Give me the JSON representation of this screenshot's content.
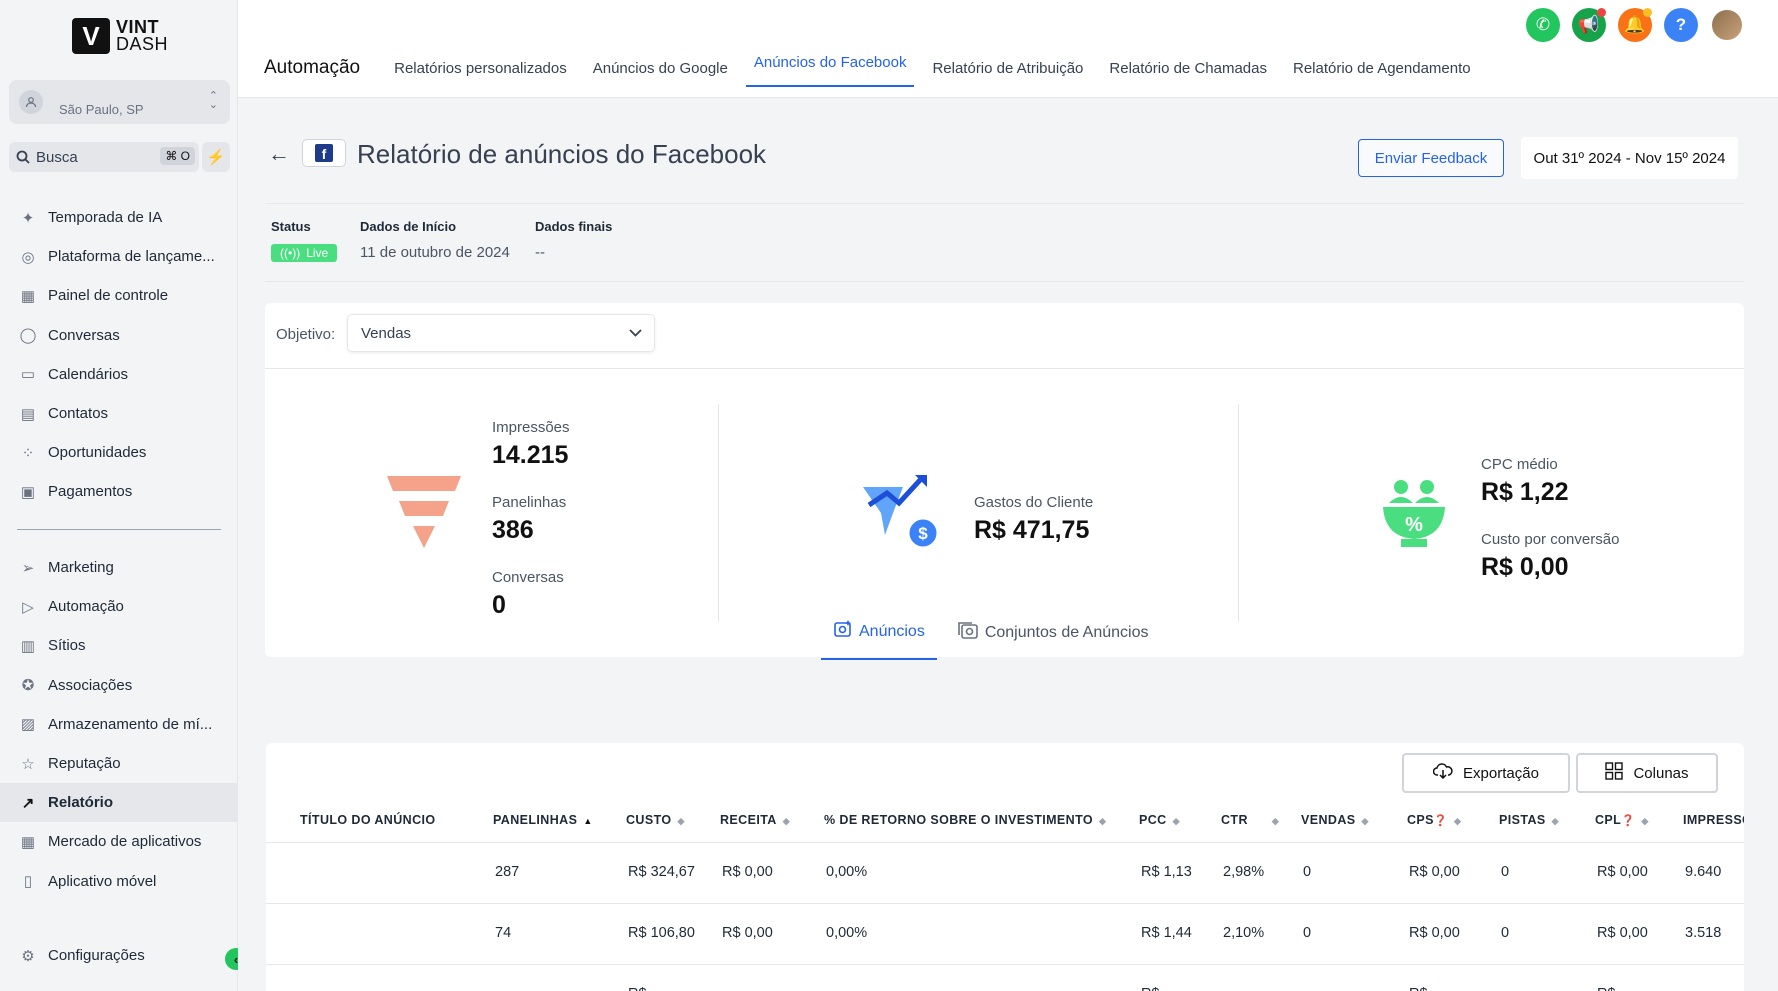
{
  "logo": {
    "mark": "V",
    "line1": "VINT",
    "line2": "DASH"
  },
  "location": {
    "name": "São Paulo, SP",
    "icon": "user-icon"
  },
  "search": {
    "placeholder": "Busca",
    "shortcut": "⌘ O"
  },
  "sidebar": {
    "items": [
      {
        "label": "Temporada de IA",
        "icon": "sparkle-icon"
      },
      {
        "label": "Plataforma de lançame...",
        "icon": "rocket-icon"
      },
      {
        "label": "Painel de controle",
        "icon": "dashboard-icon"
      },
      {
        "label": "Conversas",
        "icon": "chat-icon"
      },
      {
        "label": "Calendários",
        "icon": "calendar-icon"
      },
      {
        "label": "Contatos",
        "icon": "contacts-icon"
      },
      {
        "label": "Oportunidades",
        "icon": "pipeline-icon"
      },
      {
        "label": "Pagamentos",
        "icon": "payments-icon"
      }
    ],
    "items2": [
      {
        "label": "Marketing",
        "icon": "send-icon"
      },
      {
        "label": "Automação",
        "icon": "play-icon"
      },
      {
        "label": "Sítios",
        "icon": "website-icon"
      },
      {
        "label": "Associações",
        "icon": "badge-icon"
      },
      {
        "label": "Armazenamento de mí...",
        "icon": "image-icon"
      },
      {
        "label": "Reputação",
        "icon": "star-icon"
      },
      {
        "label": "Relatório",
        "icon": "trend-icon",
        "active": true
      },
      {
        "label": "Mercado de aplicativos",
        "icon": "apps-icon"
      },
      {
        "label": "Aplicativo móvel",
        "icon": "mobile-icon"
      }
    ],
    "settings": "Configurações"
  },
  "header": {
    "title": "Automação",
    "tabs": [
      "Relatórios personalizados",
      "Anúncios do Google",
      "Anúncios do Facebook",
      "Relatório de Atribuição",
      "Relatório de Chamadas",
      "Relatório de Agendamento"
    ],
    "active_tab": "Anúncios do Facebook"
  },
  "page": {
    "title": "Relatório de anúncios do Facebook",
    "feedback": "Enviar Feedback",
    "date_range": "Out 31º 2024 - Nov 15º 2024"
  },
  "meta": {
    "status_label": "Status",
    "status_value": "Live",
    "start_label": "Dados de Início",
    "start_value": "11 de outubro de 2024",
    "end_label": "Dados finais",
    "end_value": "--"
  },
  "objective": {
    "label": "Objetivo:",
    "value": "Vendas"
  },
  "metrics": {
    "impressions_label": "Impressões",
    "impressions": "14.215",
    "clicks_label": "Panelinhas",
    "clicks": "386",
    "conversions_label": "Conversas",
    "conversions": "0",
    "spend_label": "Gastos do Cliente",
    "spend": "R$ 471,75",
    "cpc_label": "CPC médio",
    "cpc": "R$ 1,22",
    "cpconv_label": "Custo por conversão",
    "cpconv": "R$ 0,00"
  },
  "subtabs": {
    "ads": "Anúncios",
    "adsets": "Conjuntos de Anúncios"
  },
  "table_actions": {
    "export": "Exportação",
    "columns": "Colunas"
  },
  "table": {
    "headers": [
      "Título do anúncio",
      "Panelinhas",
      "Custo",
      "Receita",
      "% de retorno sobre o investimento",
      "PCC",
      "CTR",
      "Vendas",
      "CPS",
      "Pistas",
      "CPL",
      "Impressõ"
    ],
    "rows": [
      [
        "",
        "287",
        "R$ 324,67",
        "R$ 0,00",
        "0,00%",
        "R$ 1,13",
        "2,98%",
        "0",
        "R$ 0,00",
        "0",
        "R$ 0,00",
        "9.640"
      ],
      [
        "",
        "74",
        "R$ 106,80",
        "R$ 0,00",
        "0,00%",
        "R$ 1,44",
        "2,10%",
        "0",
        "R$ 0,00",
        "0",
        "R$ 0,00",
        "3.518"
      ],
      [
        "",
        "",
        "R$",
        "",
        "",
        "R$",
        "",
        "",
        "R$",
        "",
        "R$",
        ""
      ]
    ]
  },
  "colors": {
    "accent": "#2563eb",
    "green": "#22c55e",
    "funnel": "#f4a38a",
    "spend_icon": "#3b82f6",
    "cpc_icon": "#4ade80"
  }
}
